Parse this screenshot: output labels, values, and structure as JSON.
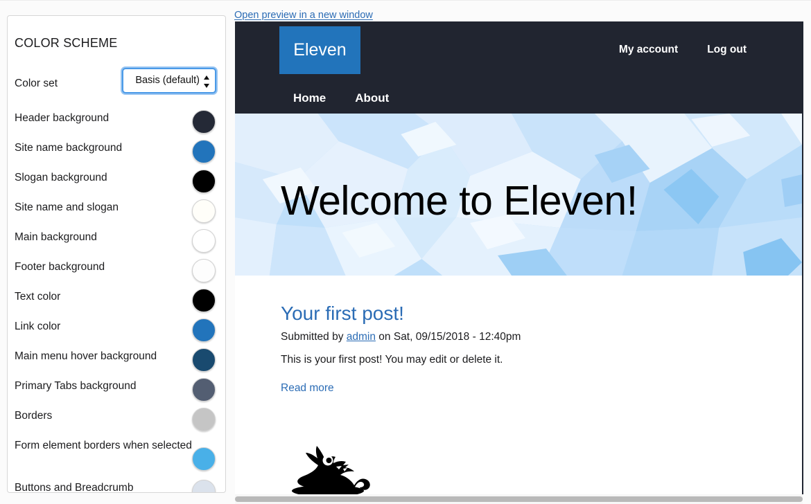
{
  "panel": {
    "title": "COLOR SCHEME",
    "color_set": {
      "label": "Color set",
      "value": "Basis (default)"
    },
    "rows": [
      {
        "label": "Header background",
        "color": "#242936"
      },
      {
        "label": "Site name background",
        "color": "#2274bb"
      },
      {
        "label": "Slogan background",
        "color": "#000000"
      },
      {
        "label": "Site name and slogan",
        "color": "#fffef9"
      },
      {
        "label": "Main background",
        "color": "#ffffff"
      },
      {
        "label": "Footer background",
        "color": "#fdfdfd"
      },
      {
        "label": "Text color",
        "color": "#000000"
      },
      {
        "label": "Link color",
        "color": "#2274bb"
      },
      {
        "label": "Main menu hover background",
        "color": "#194a6f"
      },
      {
        "label": "Primary Tabs background",
        "color": "#535e72"
      },
      {
        "label": "Borders",
        "color": "#c5c5c5"
      },
      {
        "label": "Form element borders when selected",
        "color": "#49b0e8"
      },
      {
        "label": "Buttons and Breadcrumb",
        "color": "#dbe2ec"
      }
    ]
  },
  "preview": {
    "open_link": "Open preview in a new window",
    "site_name": "Eleven",
    "user_menu": [
      "My account",
      "Log out"
    ],
    "main_menu": [
      "Home",
      "About"
    ],
    "hero_title": "Welcome to Eleven!",
    "post": {
      "title": "Your first post!",
      "submitted_prefix": "Submitted by ",
      "author": "admin",
      "submitted_suffix": " on Sat, 09/15/2018 - 12:40pm",
      "body": "This is your first post! You may edit or delete it.",
      "read_more": "Read more"
    }
  },
  "colors": {
    "link": "#2b6cb5",
    "header_bg": "#212530",
    "site_name_bg": "#2274bb",
    "hero_base": "#bfdffa"
  }
}
